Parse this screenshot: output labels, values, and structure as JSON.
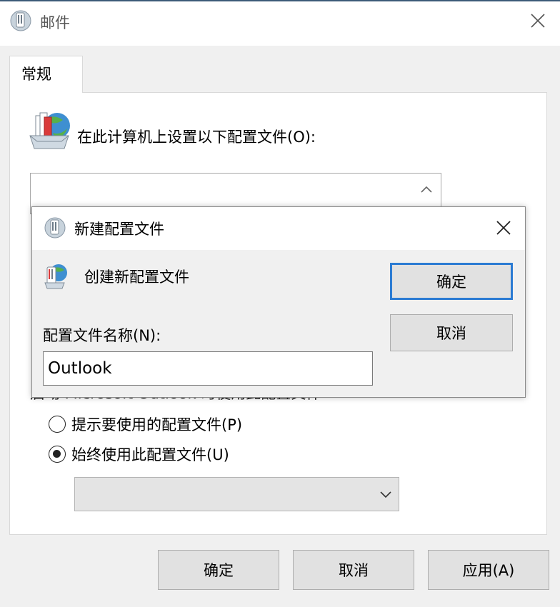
{
  "window": {
    "title": "邮件",
    "tab": "常规",
    "setup_label": "在此计算机上设置以下配置文件(O):",
    "hidden_label": "启动 Microsoft Outlook 时使用此配置文件",
    "radio_prompt": "提示要使用的配置文件(P)",
    "radio_always": "始终使用此配置文件(U)",
    "always_selected": true,
    "ok": "确定",
    "cancel": "取消",
    "apply": "应用(A)"
  },
  "dialog": {
    "title": "新建配置文件",
    "create_label": "创建新配置文件",
    "name_label": "配置文件名称(N):",
    "name_value": "Outlook",
    "ok": "确定",
    "cancel": "取消"
  },
  "colors": {
    "focus_border": "#2b7bd3",
    "background": "#f0f0f0"
  }
}
